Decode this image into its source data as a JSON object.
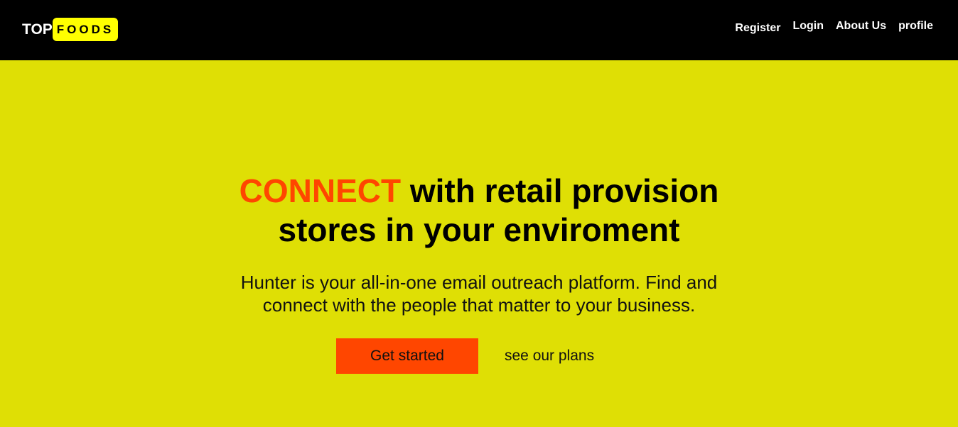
{
  "brand": {
    "part1": "TOP",
    "part2": "FOODS"
  },
  "nav": {
    "register": "Register",
    "login": "Login",
    "about": "About Us",
    "profile": "profile"
  },
  "hero": {
    "headline_accent": "CONNECT",
    "headline_line1_rest": " with retail provision",
    "headline_line2": "stores in your enviroment",
    "sub_line1": "Hunter is your all-in-one email outreach platform. Find and",
    "sub_line2": "connect with the people that matter to your business.",
    "primary_button": "Get started",
    "secondary_button": "see our plans"
  },
  "colors": {
    "background": "#dfdf05",
    "navbar": "#000000",
    "accent": "#ff4600",
    "logo_badge": "#ffff00"
  }
}
